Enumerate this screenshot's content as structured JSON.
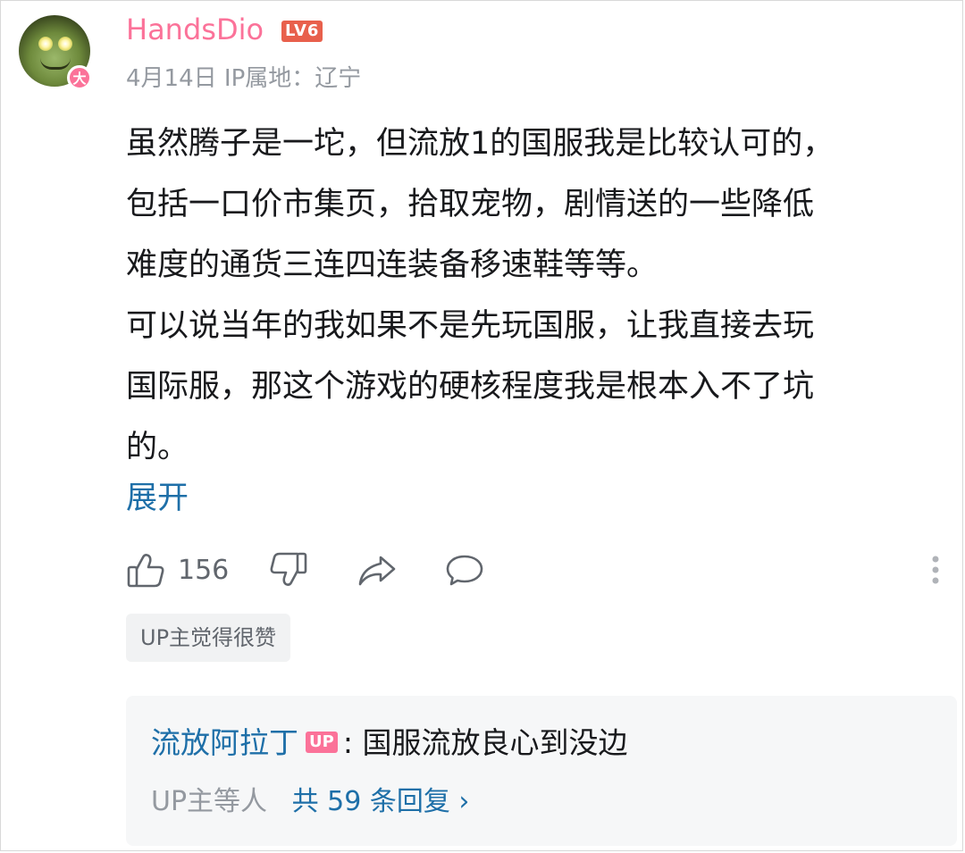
{
  "user": {
    "name": "HandsDio",
    "level_badge": "LV6",
    "avatar_badge": "大",
    "date": "4月14日",
    "ip_location": "IP属地：辽宁"
  },
  "comment": {
    "text": "虽然腾子是一坨，但流放1的国服我是比较认可的，\n包括一口价市集页，拾取宠物，剧情送的一些降低\n难度的通货三连四连装备移速鞋等等。\n可以说当年的我如果不是先玩国服，让我直接去玩\n国际服，那这个游戏的硬核程度我是根本入不了坑\n的。",
    "expand_label": "展开"
  },
  "actions": {
    "like_count": "156"
  },
  "up_liked_label": "UP主觉得很赞",
  "reply_preview": {
    "author": "流放阿拉丁",
    "author_tag": "UP",
    "separator": ":",
    "text": "国服流放良心到没边",
    "others_label": "UP主等人",
    "count_label": "共 59 条回复",
    "chevron": "›"
  },
  "colors": {
    "username": "#fb7299",
    "link": "#1e6fa8",
    "meta": "#9499a0",
    "text": "#18191c"
  },
  "icons": [
    "thumbs-up-icon",
    "thumbs-down-icon",
    "share-icon",
    "comment-icon",
    "more-vertical-icon"
  ]
}
